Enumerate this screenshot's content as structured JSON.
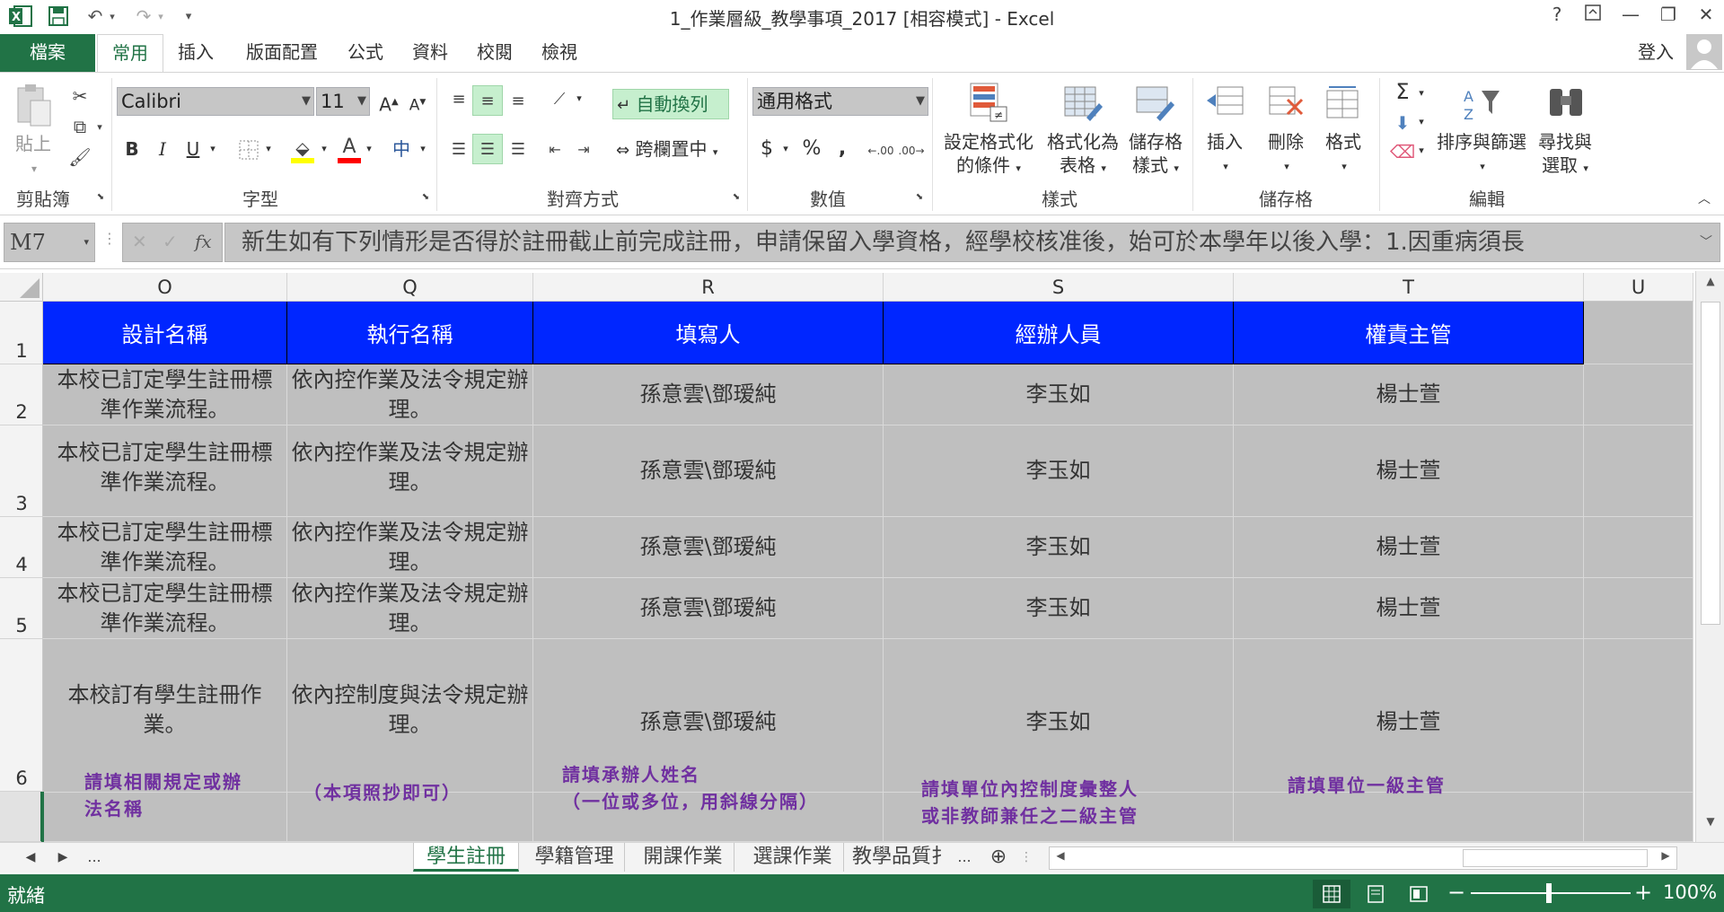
{
  "window": {
    "title": "1_作業層級_教學事項_2017  [相容模式] - Excel",
    "help": "?",
    "sign_in": "登入"
  },
  "ribbon_tabs": [
    "檔案",
    "常用",
    "插入",
    "版面配置",
    "公式",
    "資料",
    "校閱",
    "檢視"
  ],
  "clipboard": {
    "paste": "貼上",
    "group": "剪貼簿"
  },
  "font": {
    "name": "Calibri",
    "size": "11",
    "bold": "B",
    "italic": "I",
    "underline": "U",
    "grow": "A",
    "shrink": "A",
    "color_letter": "A",
    "phonetic": "中",
    "group": "字型"
  },
  "alignment": {
    "wrap": "自動換列",
    "merge": "跨欄置中",
    "group": "對齊方式"
  },
  "number": {
    "format": "通用格式",
    "currency": "$",
    "percent": "%",
    "comma": ",",
    "group": "數值"
  },
  "styles": {
    "conditional": [
      "設定格式化",
      "的條件"
    ],
    "table": [
      "格式化為",
      "表格"
    ],
    "cell": [
      "儲存格",
      "樣式"
    ],
    "group": "樣式"
  },
  "cells": {
    "insert": "插入",
    "delete": "刪除",
    "format": "格式",
    "group": "儲存格"
  },
  "editing": {
    "sigma": "Σ",
    "sort": "排序與篩選",
    "find": [
      "尋找與",
      "選取"
    ],
    "group": "編輯"
  },
  "formula_bar": {
    "name_box": "M7",
    "fx": "fx",
    "content": "新生如有下列情形是否得於註冊截止前完成註冊，申請保留入學資格，經學校核准後，始可於本學年以後入學：1.因重病須長"
  },
  "columns": [
    "O",
    "Q",
    "R",
    "S",
    "T",
    "U"
  ],
  "rows": [
    "1",
    "2",
    "3",
    "4",
    "5",
    "6"
  ],
  "table": {
    "headers": [
      "設計名稱",
      "執行名稱",
      "填寫人",
      "經辦人員",
      "權責主管"
    ],
    "rows": [
      [
        "本校已訂定學生註冊標準作業流程。",
        "依內控作業及法令規定辦理。",
        "孫意雲\\鄧瑷純",
        "李玉如",
        "楊士萱"
      ],
      [
        "本校已訂定學生註冊標準作業流程。",
        "依內控作業及法令規定辦理。",
        "孫意雲\\鄧瑷純",
        "李玉如",
        "楊士萱"
      ],
      [
        "本校已訂定學生註冊標準作業流程。",
        "依內控作業及法令規定辦理。",
        "孫意雲\\鄧瑷純",
        "李玉如",
        "楊士萱"
      ],
      [
        "本校已訂定學生註冊標準作業流程。",
        "依內控作業及法令規定辦理。",
        "孫意雲\\鄧瑷純",
        "李玉如",
        "楊士萱"
      ],
      [
        "本校訂有學生註冊作業。",
        "依內控制度與法令規定辦理。",
        "孫意雲\\鄧瑷純",
        "李玉如",
        "楊士萱"
      ]
    ]
  },
  "notes": {
    "design": [
      "請填相關規定或辦",
      "法名稱"
    ],
    "exec": "（本項照抄即可）",
    "filler": [
      "請填承辦人姓名",
      "（一位或多位，用斜線分隔）"
    ],
    "handler": [
      "請填單位內控制度彙整人",
      "或非教師兼任之二級主管"
    ],
    "supervisor": "請填單位一級主管"
  },
  "sheet_tabs": [
    "學生註冊",
    "學籍管理",
    "開課作業",
    "選課作業",
    "教學品質扌"
  ],
  "sheet_nav_more": "...",
  "sheet_tabs_more": "...",
  "status": {
    "ready": "就緒",
    "zoom": "100%",
    "minus": "−",
    "plus": "+"
  },
  "colors": {
    "excel_green": "#217346",
    "header_blue": "#0026ff",
    "cell_gray": "#bfbfbf",
    "note_purple": "#7030a0"
  }
}
